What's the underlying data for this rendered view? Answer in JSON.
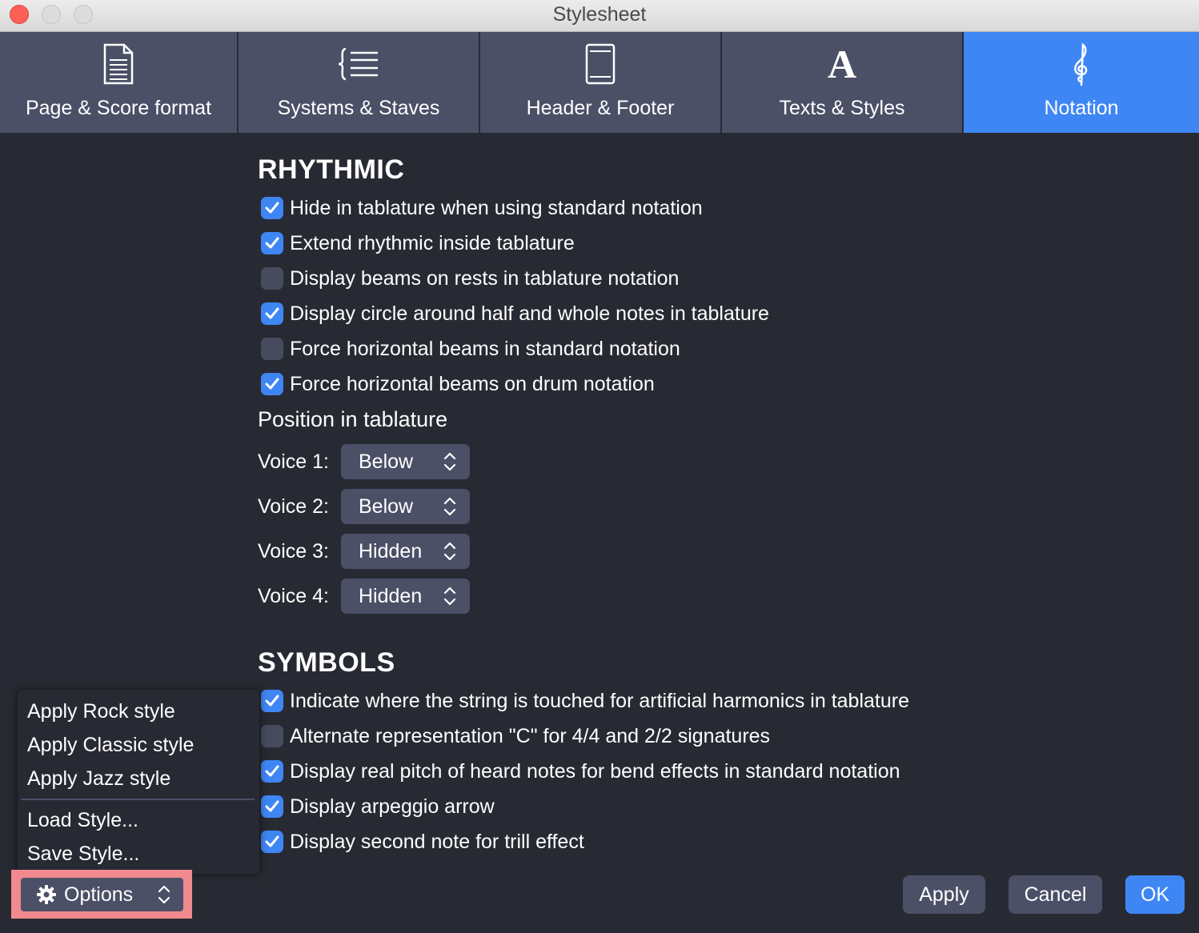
{
  "window": {
    "title": "Stylesheet"
  },
  "tabs": [
    {
      "label": "Page & Score format",
      "icon": "page-icon"
    },
    {
      "label": "Systems & Staves",
      "icon": "systems-icon"
    },
    {
      "label": "Header & Footer",
      "icon": "header-footer-icon"
    },
    {
      "label": "Texts & Styles",
      "icon": "text-a-icon"
    },
    {
      "label": "Notation",
      "icon": "treble-clef-icon",
      "active": true
    }
  ],
  "rhythmic": {
    "title": "RHYTHMIC",
    "options": [
      {
        "label": "Hide in tablature when using standard notation",
        "checked": true
      },
      {
        "label": "Extend rhythmic inside tablature",
        "checked": true
      },
      {
        "label": "Display beams on rests in tablature notation",
        "checked": false
      },
      {
        "label": "Display circle around half and whole notes in tablature",
        "checked": true
      },
      {
        "label": "Force horizontal beams in standard notation",
        "checked": false
      },
      {
        "label": "Force horizontal beams on drum notation",
        "checked": true
      }
    ],
    "position_title": "Position in tablature",
    "voices": [
      {
        "label": "Voice 1:",
        "value": "Below"
      },
      {
        "label": "Voice 2:",
        "value": "Below"
      },
      {
        "label": "Voice 3:",
        "value": "Hidden"
      },
      {
        "label": "Voice 4:",
        "value": "Hidden"
      }
    ]
  },
  "symbols": {
    "title": "SYMBOLS",
    "options": [
      {
        "label": "Indicate where the string is touched for artificial harmonics in tablature",
        "checked": true
      },
      {
        "label": "Alternate representation \"C\" for 4/4 and 2/2 signatures",
        "checked": false
      },
      {
        "label": "Display real pitch of heard notes for bend effects in standard notation",
        "checked": true
      },
      {
        "label": "Display arpeggio arrow",
        "checked": true
      },
      {
        "label": "Display second note for trill effect",
        "checked": true
      }
    ]
  },
  "options_menu": {
    "items": [
      "Apply Rock style",
      "Apply Classic style",
      "Apply Jazz style",
      "Load Style...",
      "Save Style..."
    ]
  },
  "footer": {
    "options_label": "Options",
    "apply_label": "Apply",
    "cancel_label": "Cancel",
    "ok_label": "OK"
  },
  "colors": {
    "background": "#282a33",
    "tab": "#4b5067",
    "accent": "#3f86f5",
    "highlight": "#f08a8f"
  }
}
